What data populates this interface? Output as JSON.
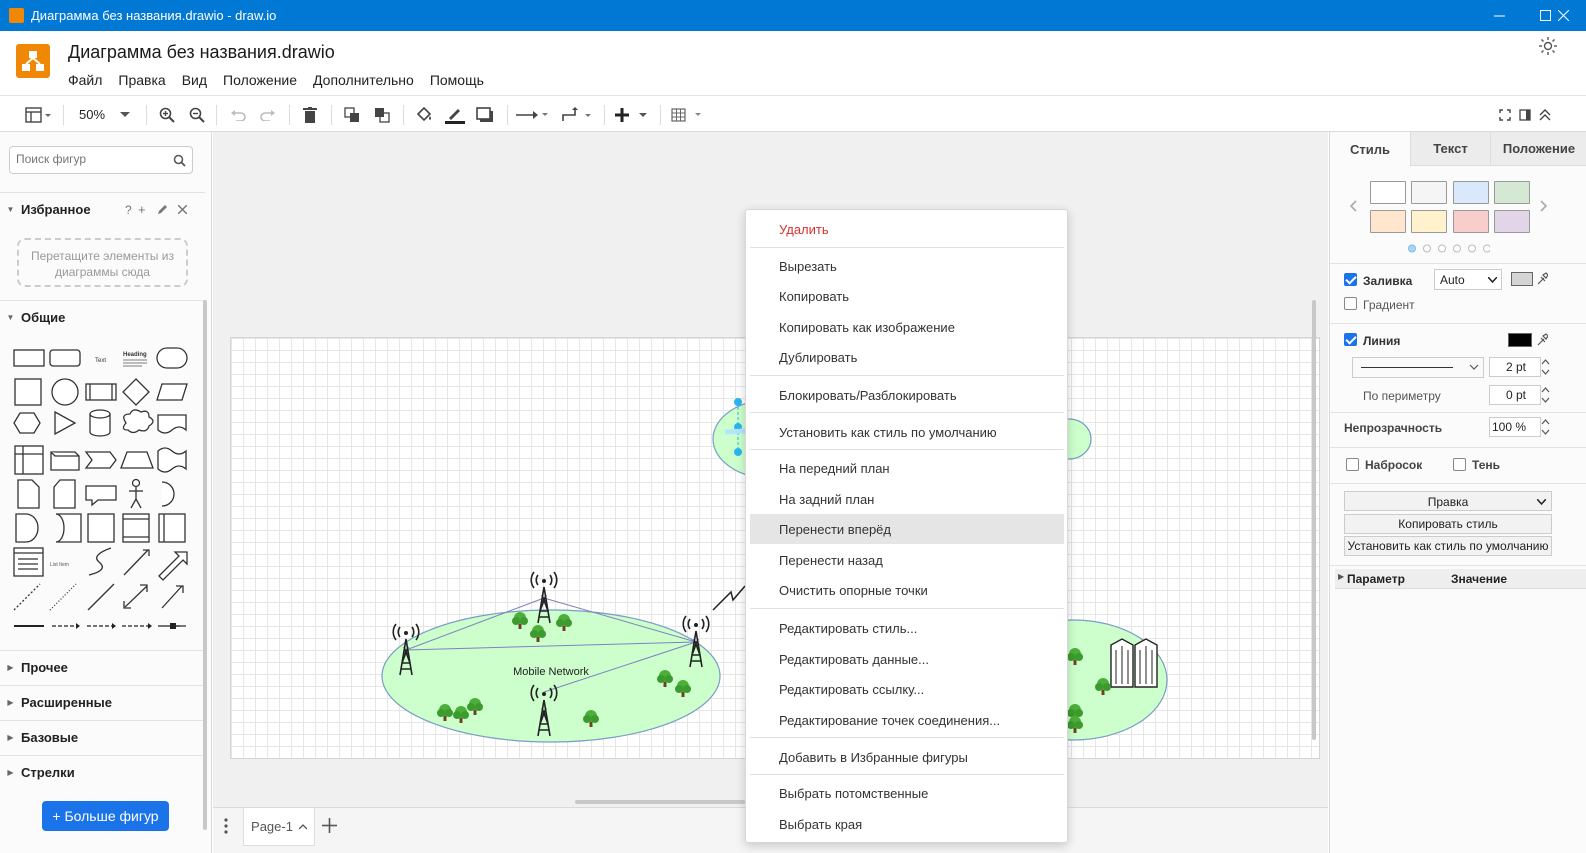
{
  "window": {
    "title": "Диаграмма без названия.drawio - draw.io"
  },
  "document": {
    "title": "Диаграмма без названия.drawio"
  },
  "menu": [
    "Файл",
    "Правка",
    "Вид",
    "Положение",
    "Дополнительно",
    "Помощь"
  ],
  "toolbar": {
    "zoom": "50%"
  },
  "sidebar": {
    "search_placeholder": "Поиск фигур",
    "favorites_title": "Избранное",
    "favorites_help": "?",
    "favorites_drop": "Перетащите элементы из диаграммы сюда",
    "general_title": "Общие",
    "sections": [
      "Прочее",
      "Расширенные",
      "Базовые",
      "Стрелки"
    ],
    "shape_labels": {
      "text": "Text",
      "heading": "Heading",
      "list": "List Item"
    },
    "more_shapes": "+ Больше фигур"
  },
  "diagram": {
    "network_label": "Mobile Network"
  },
  "pages": {
    "tab": "Page-1"
  },
  "context_menu": {
    "items": [
      "Удалить",
      "Вырезать",
      "Копировать",
      "Копировать как изображение",
      "Дублировать",
      "Блокировать/Разблокировать",
      "Установить как стиль по умолчанию",
      "На передний план",
      "На задний план",
      "Перенести вперёд",
      "Перенести назад",
      "Очистить опорные точки",
      "Редактировать стиль...",
      "Редактировать данные...",
      "Редактировать ссылку...",
      "Редактирование точек соединения...",
      "Добавить в Избранные фигуры",
      "Выбрать потомственные",
      "Выбрать края"
    ],
    "highlighted": "Перенести вперёд",
    "danger_color": "#d9302c"
  },
  "format": {
    "tabs": [
      "Стиль",
      "Текст",
      "Положение"
    ],
    "swatches": [
      "#ffffff",
      "#f5f5f5",
      "#dae8fc",
      "#d5e8d4",
      "#ffe6cc",
      "#fff2cc",
      "#f8cecc",
      "#e1d5e7"
    ],
    "fill_label": "Заливка",
    "fill_mode": "Auto",
    "gradient_label": "Градиент",
    "line_label": "Линия",
    "line_width": "2 pt",
    "perimeter_label": "По периметру",
    "perimeter_value": "0 pt",
    "opacity_label": "Непрозрачность",
    "opacity_value": "100 %",
    "sketch_label": "Набросок",
    "shadow_label": "Тень",
    "edit_select": "Правка",
    "copy_style": "Копировать стиль",
    "set_default": "Установить как стиль по умолчанию",
    "param_header": "Параметр",
    "value_header": "Значение"
  },
  "colors": {
    "accent": "#1a73e8",
    "titlebar": "#0078d4",
    "logo": "#f08705",
    "ellipse_fill": "#ccffcc"
  }
}
